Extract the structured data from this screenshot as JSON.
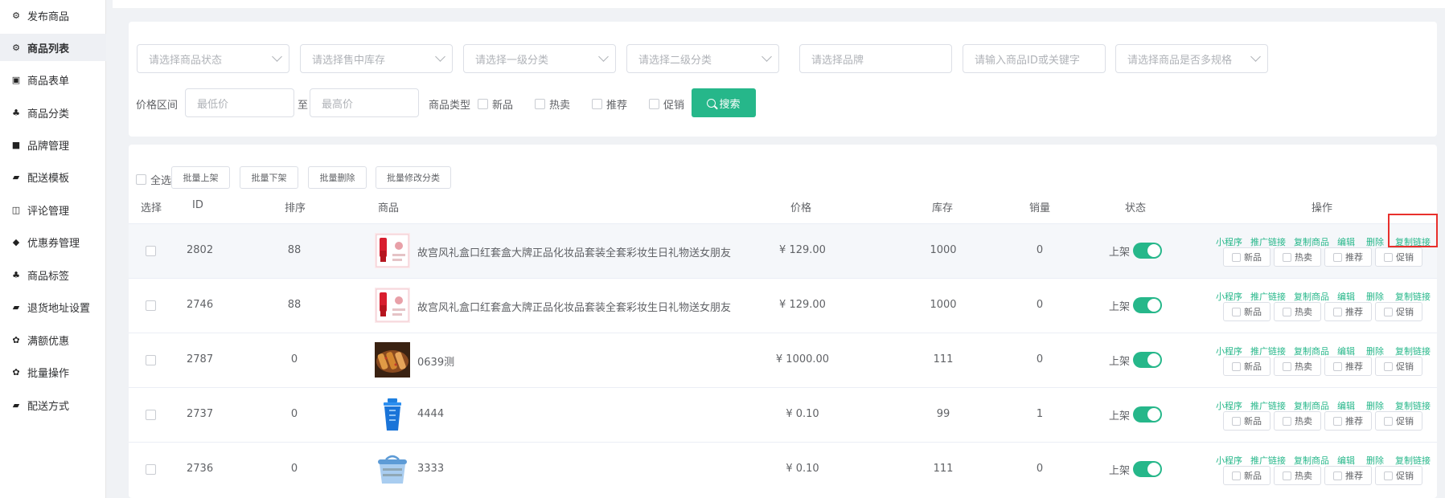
{
  "sidebar": {
    "items": [
      {
        "icon": "cubes-icon",
        "glyph": "⚙",
        "label": "发布商品"
      },
      {
        "icon": "cubes-icon",
        "glyph": "⚙",
        "label": "商品列表",
        "active": true
      },
      {
        "icon": "file-icon",
        "glyph": "▣",
        "label": "商品表单"
      },
      {
        "icon": "sitemap-icon",
        "glyph": "♣",
        "label": "商品分类"
      },
      {
        "icon": "briefcase-icon",
        "glyph": "■",
        "label": "品牌管理"
      },
      {
        "icon": "truck-icon",
        "glyph": "▰",
        "label": "配送模板"
      },
      {
        "icon": "columns-icon",
        "glyph": "◫",
        "label": "评论管理"
      },
      {
        "icon": "tags-icon",
        "glyph": "◆",
        "label": "优惠券管理"
      },
      {
        "icon": "sitemap-icon",
        "glyph": "♣",
        "label": "商品标签"
      },
      {
        "icon": "truck-icon",
        "glyph": "▰",
        "label": "退货地址设置"
      },
      {
        "icon": "gift-icon",
        "glyph": "✿",
        "label": "满额优惠"
      },
      {
        "icon": "gift-icon",
        "glyph": "✿",
        "label": "批量操作"
      },
      {
        "icon": "truck-icon",
        "glyph": "▰",
        "label": "配送方式"
      }
    ]
  },
  "filters": {
    "status_placeholder": "请选择商品状态",
    "stock_placeholder": "请选择售中库存",
    "cat1_placeholder": "请选择一级分类",
    "cat2_placeholder": "请选择二级分类",
    "brand_placeholder": "请选择品牌",
    "keyword_placeholder": "请输入商品ID或关键字",
    "spec_placeholder": "请选择商品是否多规格",
    "price_label": "价格区间",
    "min_placeholder": "最低价",
    "to_label": "至",
    "max_placeholder": "最高价",
    "type_label": "商品类型",
    "types": [
      "新品",
      "热卖",
      "推荐",
      "促销"
    ],
    "search_label": "搜索"
  },
  "batch": {
    "select_all": "全选",
    "buttons": [
      "批量上架",
      "批量下架",
      "批量删除",
      "批量修改分类"
    ]
  },
  "table": {
    "headers": {
      "select": "选择",
      "id": "ID",
      "sort": "排序",
      "product": "商品",
      "price": "价格",
      "stock": "库存",
      "sales": "销量",
      "status": "状态",
      "ops": "操作"
    },
    "op_links": [
      "小程序",
      "推广链接",
      "复制商品",
      "编辑",
      "删除",
      "复制链接"
    ],
    "tag_labels": [
      "新品",
      "热卖",
      "推荐",
      "促销"
    ],
    "status_text": "上架",
    "rows": [
      {
        "id": "2802",
        "sort": "88",
        "name": "故宫风礼盒口红套盒大牌正品化妆品套装全套彩妆生日礼物送女朋友",
        "price": "¥ 129.00",
        "stock": "1000",
        "sales": "0",
        "thumb": "lipstick"
      },
      {
        "id": "2746",
        "sort": "88",
        "name": "故宫风礼盒口红套盒大牌正品化妆品套装全套彩妆生日礼物送女朋友",
        "price": "¥ 129.00",
        "stock": "1000",
        "sales": "0",
        "thumb": "lipstick"
      },
      {
        "id": "2787",
        "sort": "0",
        "name": "0639测",
        "price": "¥ 1000.00",
        "stock": "111",
        "sales": "0",
        "thumb": "food"
      },
      {
        "id": "2737",
        "sort": "0",
        "name": "4444",
        "price": "¥ 0.10",
        "stock": "99",
        "sales": "1",
        "thumb": "cup"
      },
      {
        "id": "2736",
        "sort": "0",
        "name": "3333",
        "price": "¥ 0.10",
        "stock": "111",
        "sales": "0",
        "thumb": "basket"
      }
    ]
  },
  "colors": {
    "accent": "#26b78a",
    "highlight": "#e8302c"
  }
}
